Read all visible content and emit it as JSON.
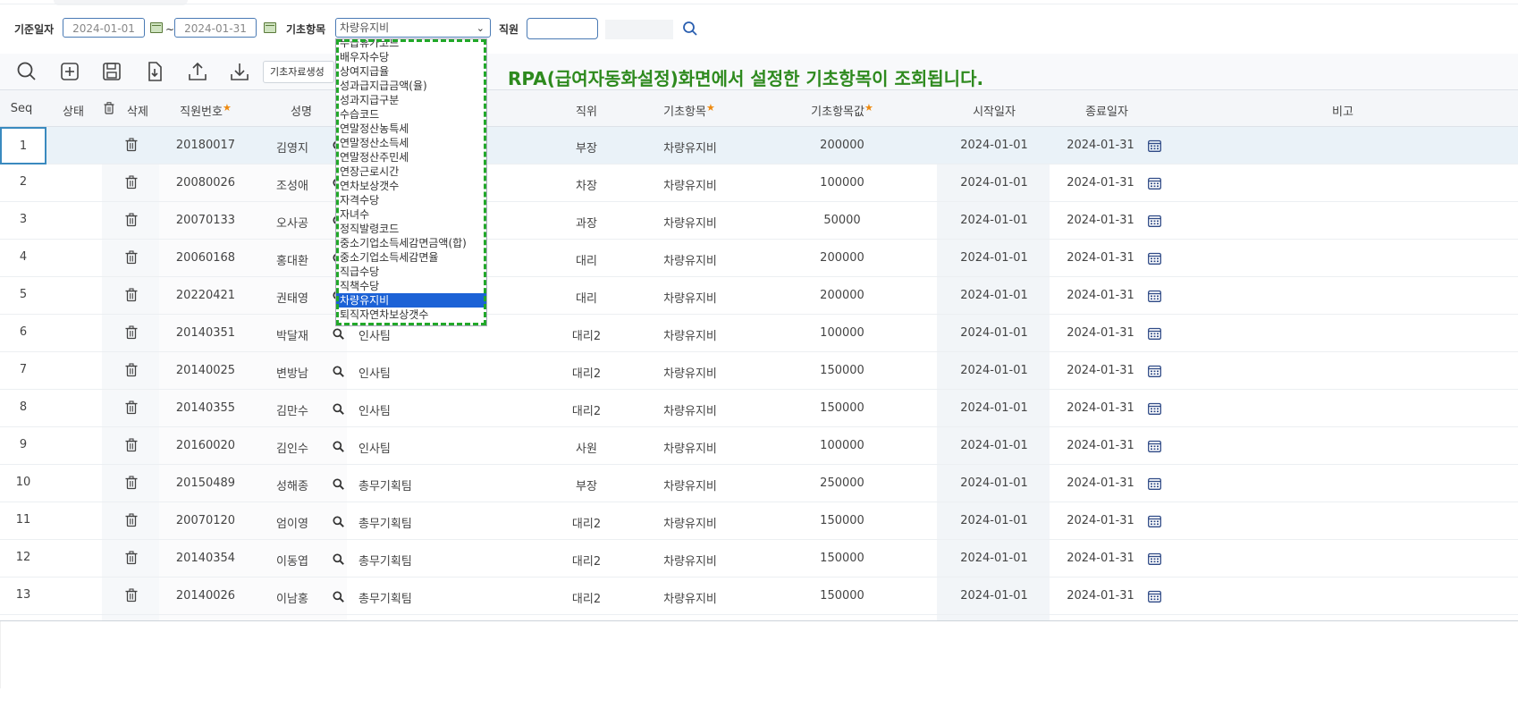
{
  "search": {
    "base_date_label": "기준일자",
    "date_from": "2024-01-01",
    "date_sep": "~",
    "date_to": "2024-01-31",
    "item_label": "기초항목",
    "item_selected": "차량유지비",
    "employee_label": "직원",
    "employee_value": ""
  },
  "toolbar": {
    "generate_label": "기초자료생성"
  },
  "notice": "RPA(급여자동화설정)화면에서 설정한 기초항목이 조회됩니다.",
  "grid": {
    "headers": {
      "seq": "Seq",
      "status": "상태",
      "delete": "삭제",
      "emp_no": "직원번호",
      "name": "성명",
      "position": "직위",
      "item": "기초항목",
      "value": "기초항목값",
      "start": "시작일자",
      "end": "종료일자",
      "note": "비고"
    },
    "rows": [
      {
        "seq": "1",
        "emp_no": "20180017",
        "name": "김영지",
        "dept": "",
        "position": "부장",
        "item": "차량유지비",
        "value": "200000",
        "start": "2024-01-01",
        "end": "2024-01-31"
      },
      {
        "seq": "2",
        "emp_no": "20080026",
        "name": "조성애",
        "dept": "",
        "position": "차장",
        "item": "차량유지비",
        "value": "100000",
        "start": "2024-01-01",
        "end": "2024-01-31"
      },
      {
        "seq": "3",
        "emp_no": "20070133",
        "name": "오사공",
        "dept": "",
        "position": "과장",
        "item": "차량유지비",
        "value": "50000",
        "start": "2024-01-01",
        "end": "2024-01-31"
      },
      {
        "seq": "4",
        "emp_no": "20060168",
        "name": "홍대환",
        "dept": "",
        "position": "대리",
        "item": "차량유지비",
        "value": "200000",
        "start": "2024-01-01",
        "end": "2024-01-31"
      },
      {
        "seq": "5",
        "emp_no": "20220421",
        "name": "권태영",
        "dept": "",
        "position": "대리",
        "item": "차량유지비",
        "value": "200000",
        "start": "2024-01-01",
        "end": "2024-01-31"
      },
      {
        "seq": "6",
        "emp_no": "20140351",
        "name": "박달재",
        "dept": "인사팀",
        "position": "대리2",
        "item": "차량유지비",
        "value": "100000",
        "start": "2024-01-01",
        "end": "2024-01-31"
      },
      {
        "seq": "7",
        "emp_no": "20140025",
        "name": "변방남",
        "dept": "인사팀",
        "position": "대리2",
        "item": "차량유지비",
        "value": "150000",
        "start": "2024-01-01",
        "end": "2024-01-31"
      },
      {
        "seq": "8",
        "emp_no": "20140355",
        "name": "김만수",
        "dept": "인사팀",
        "position": "대리2",
        "item": "차량유지비",
        "value": "150000",
        "start": "2024-01-01",
        "end": "2024-01-31"
      },
      {
        "seq": "9",
        "emp_no": "20160020",
        "name": "김인수",
        "dept": "인사팀",
        "position": "사원",
        "item": "차량유지비",
        "value": "100000",
        "start": "2024-01-01",
        "end": "2024-01-31"
      },
      {
        "seq": "10",
        "emp_no": "20150489",
        "name": "성해종",
        "dept": "총무기획팀",
        "position": "부장",
        "item": "차량유지비",
        "value": "250000",
        "start": "2024-01-01",
        "end": "2024-01-31"
      },
      {
        "seq": "11",
        "emp_no": "20070120",
        "name": "엄이영",
        "dept": "총무기획팀",
        "position": "대리2",
        "item": "차량유지비",
        "value": "150000",
        "start": "2024-01-01",
        "end": "2024-01-31"
      },
      {
        "seq": "12",
        "emp_no": "20140354",
        "name": "이동엽",
        "dept": "총무기획팀",
        "position": "대리2",
        "item": "차량유지비",
        "value": "150000",
        "start": "2024-01-01",
        "end": "2024-01-31"
      },
      {
        "seq": "13",
        "emp_no": "20140026",
        "name": "이남홍",
        "dept": "총무기획팀",
        "position": "대리2",
        "item": "차량유지비",
        "value": "150000",
        "start": "2024-01-01",
        "end": "2024-01-31"
      }
    ]
  },
  "dropdown": {
    "items": [
      "무급휴가코드",
      "배우자수당",
      "상여지급율",
      "성과급지급금액(율)",
      "성과지급구분",
      "수습코드",
      "연말정산농특세",
      "연말정산소득세",
      "연말정산주민세",
      "연장근로시간",
      "연차보상갯수",
      "자격수당",
      "자녀수",
      "정직발령코드",
      "중소기업소득세감면금액(합)",
      "중소기업소득세감면율",
      "직급수당",
      "직책수당",
      "차량유지비",
      "퇴직자연차보상갯수"
    ],
    "selected_index": 18
  },
  "colors": {
    "accent": "#4a7ab4",
    "notice": "#2e8a1e",
    "highlight": "#22a82a",
    "selected": "#1c62d6"
  }
}
